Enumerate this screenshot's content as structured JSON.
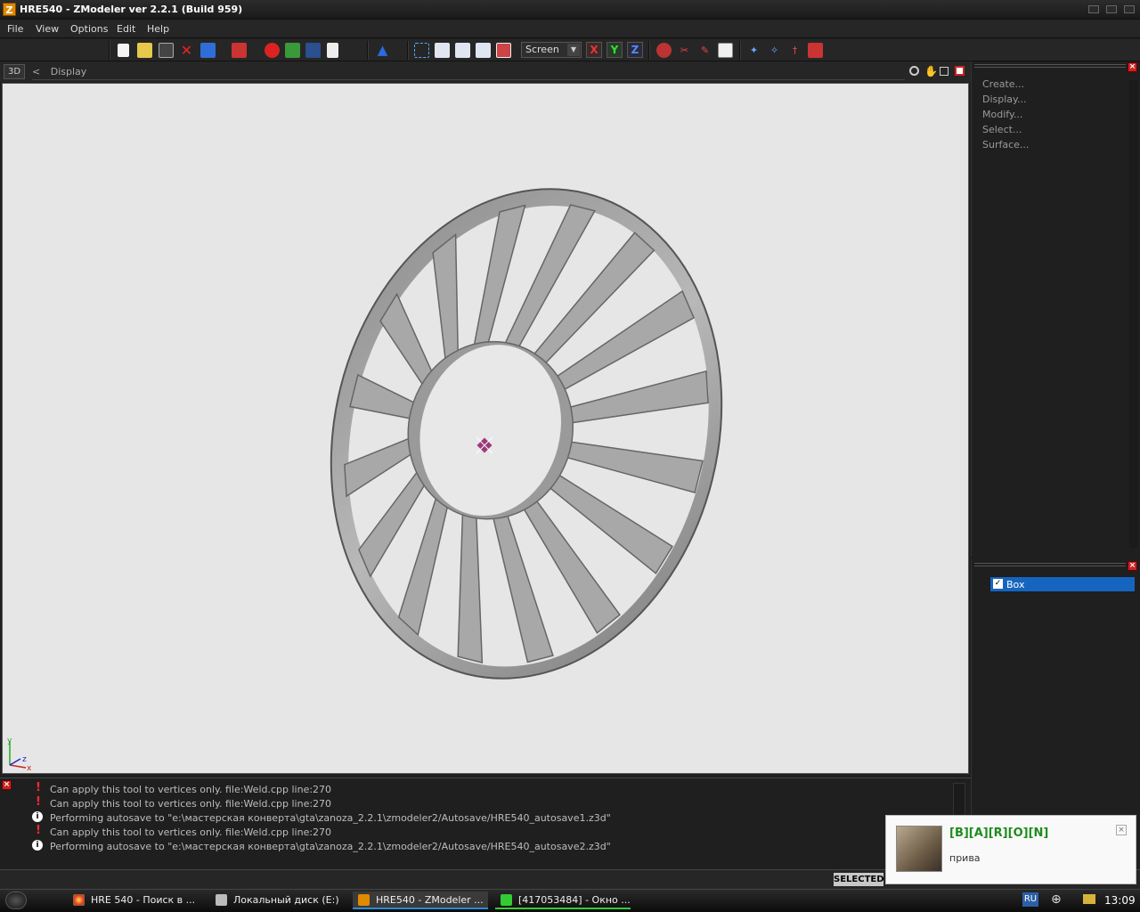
{
  "window": {
    "title": "HRE540 - ZModeler ver 2.2.1 (Build 959)",
    "icon_letter": "Z"
  },
  "menu": [
    "File",
    "View",
    "Options",
    "Edit",
    "Help"
  ],
  "toolbar": {
    "space_select": "Screen",
    "axes": [
      "X",
      "Y",
      "Z"
    ]
  },
  "viewbar": {
    "mode": "3D",
    "crumb_arrow": "<",
    "crumb": "Display"
  },
  "commands": [
    "Create...",
    "Display...",
    "Modify...",
    "Select...",
    "Surface..."
  ],
  "objects": [
    {
      "name": "Box",
      "checked": true
    }
  ],
  "console": [
    {
      "type": "warning",
      "text": "Can apply this tool to vertices only. file:Weld.cpp line:270"
    },
    {
      "type": "warning",
      "text": "Can apply this tool to vertices only. file:Weld.cpp line:270"
    },
    {
      "type": "info",
      "text": "Performing autosave to \"e:\\мастерская конверта\\gta\\zanoza_2.2.1\\zmodeler2/Autosave/HRE540_autosave1.z3d\""
    },
    {
      "type": "warning",
      "text": "Can apply this tool to vertices only. file:Weld.cpp line:270"
    },
    {
      "type": "info",
      "text": "Performing autosave to \"e:\\мастерская конверта\\gta\\zanoza_2.2.1\\zmodeler2/Autosave/HRE540_autosave2.z3d\""
    }
  ],
  "status": {
    "selected_label": "SELECTED"
  },
  "notification": {
    "name": "[B][A][R][O][N]",
    "message": "прива"
  },
  "taskbar": {
    "tasks": [
      "HRE 540 - Поиск в ...",
      "Локальный диск (E:)",
      "HRE540 - ZModeler ...",
      "[417053484] - Окно ..."
    ],
    "lang": "RU",
    "clock": "13:09"
  },
  "gizmo": {
    "y": "y",
    "z": "z",
    "x": "x"
  },
  "colors": {
    "viewport_bg": "#e6e6e6",
    "selection": "#1565c0",
    "notif_name": "#1e8c1e",
    "warning": "#ff2a2a"
  }
}
